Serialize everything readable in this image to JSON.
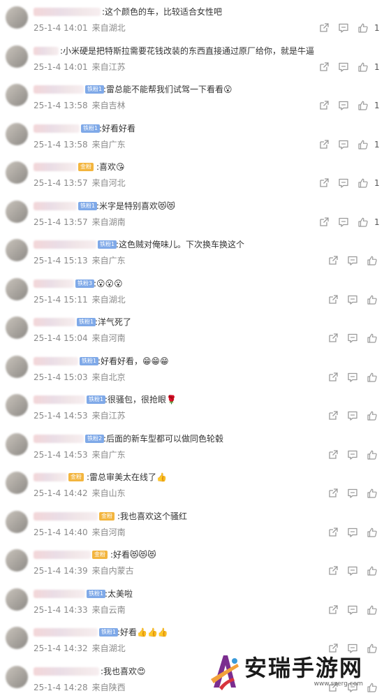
{
  "comments": [
    {
      "text": ":这个颜色的车，比较适合女性吧",
      "date": "25-1-4 14:01",
      "location": "来自湖北",
      "likes": "1",
      "badge": ""
    },
    {
      "text": ":小米硬是把特斯拉需要花钱改装的东西直接通过原厂给你，就是牛逼",
      "date": "25-1-4 14:01",
      "location": "来自江苏",
      "likes": "1",
      "badge": ""
    },
    {
      "text": ":雷总能不能帮我们试驾一下看看😮",
      "date": "25-1-4 13:58",
      "location": "来自吉林",
      "likes": "1",
      "badge": "铁粉1"
    },
    {
      "text": ":好看好看",
      "date": "25-1-4 13:58",
      "location": "来自广东",
      "likes": "1",
      "badge": "铁粉1"
    },
    {
      "text": ":喜欢😘",
      "date": "25-1-4 13:57",
      "location": "来自河北",
      "likes": "1",
      "badge": "金粉"
    },
    {
      "text": ":米字是特别喜欢😻😻",
      "date": "25-1-4 13:57",
      "location": "来自湖南",
      "likes": "1",
      "badge": "铁粉1"
    },
    {
      "text": ":这色贼对俺味儿。下次换车换这个",
      "date": "25-1-4 15:13",
      "location": "来自广东",
      "likes": "",
      "badge": "铁粉1"
    },
    {
      "text": ":😮😮😮",
      "date": "25-1-4 15:11",
      "location": "来自湖北",
      "likes": "",
      "badge": "铁粉3"
    },
    {
      "text": ":洋气死了",
      "date": "25-1-4 15:04",
      "location": "来自河南",
      "likes": "",
      "badge": "铁粉1"
    },
    {
      "text": ":好看好看，😁😁😁",
      "date": "25-1-4 15:03",
      "location": "来自北京",
      "likes": "",
      "badge": "铁粉1"
    },
    {
      "text": ":很骚包，很抢眼🌹",
      "date": "25-1-4 14:53",
      "location": "来自江苏",
      "likes": "",
      "badge": "铁粉1"
    },
    {
      "text": ":后面的新车型都可以做同色轮毂",
      "date": "25-1-4 14:53",
      "location": "来自广东",
      "likes": "",
      "badge": "铁粉2"
    },
    {
      "text": ":雷总审美太在线了👍",
      "date": "25-1-4 14:42",
      "location": "来自山东",
      "likes": "",
      "badge": "金粉"
    },
    {
      "text": ":我也喜欢这个骚红",
      "date": "25-1-4 14:40",
      "location": "来自河南",
      "likes": "",
      "badge": "金粉"
    },
    {
      "text": ":好看😻😻😻",
      "date": "25-1-4 14:39",
      "location": "来自内蒙古",
      "likes": "",
      "badge": "金粉"
    },
    {
      "text": ":太美啦",
      "date": "25-1-4 14:33",
      "location": "来自云南",
      "likes": "",
      "badge": "铁粉1"
    },
    {
      "text": ":好看👍👍👍",
      "date": "25-1-4 14:32",
      "location": "来自湖北",
      "likes": "",
      "badge": "铁粉1"
    },
    {
      "text": ":我也喜欢😍",
      "date": "25-1-4 14:28",
      "location": "来自陕西",
      "likes": "",
      "badge": ""
    }
  ],
  "watermark": {
    "title": "安瑞手游网",
    "url": "www.szerg.com"
  },
  "colors": {
    "meta": "#8a8a8a",
    "badge_blue": "#7fa9e8",
    "badge_gold": "#f3b53e",
    "icon": "#9a9a9a"
  }
}
